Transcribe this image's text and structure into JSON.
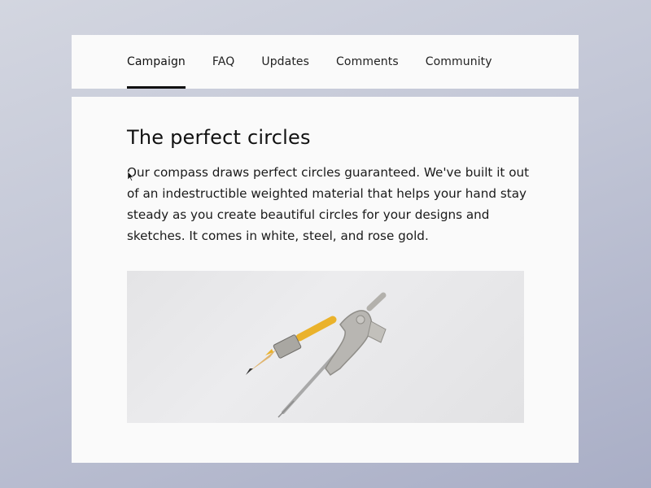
{
  "nav": {
    "tabs": [
      {
        "label": "Campaign",
        "active": true
      },
      {
        "label": "FAQ",
        "active": false
      },
      {
        "label": "Updates",
        "active": false
      },
      {
        "label": "Comments",
        "active": false
      },
      {
        "label": "Community",
        "active": false
      }
    ]
  },
  "content": {
    "title": "The perfect circles",
    "body": "Our compass draws perfect circles guaranteed. We've built it out of an indestructible weighted material that helps your hand stay steady as you create beautiful circles for your designs and sketches. It comes in white, steel, and rose gold.",
    "image": {
      "alt": "drafting compass with yellow pencil",
      "icon": "compass-image"
    }
  },
  "colors": {
    "accent": "#111111",
    "card_background": "#fafafa",
    "page_background": "#c2c6d6"
  }
}
